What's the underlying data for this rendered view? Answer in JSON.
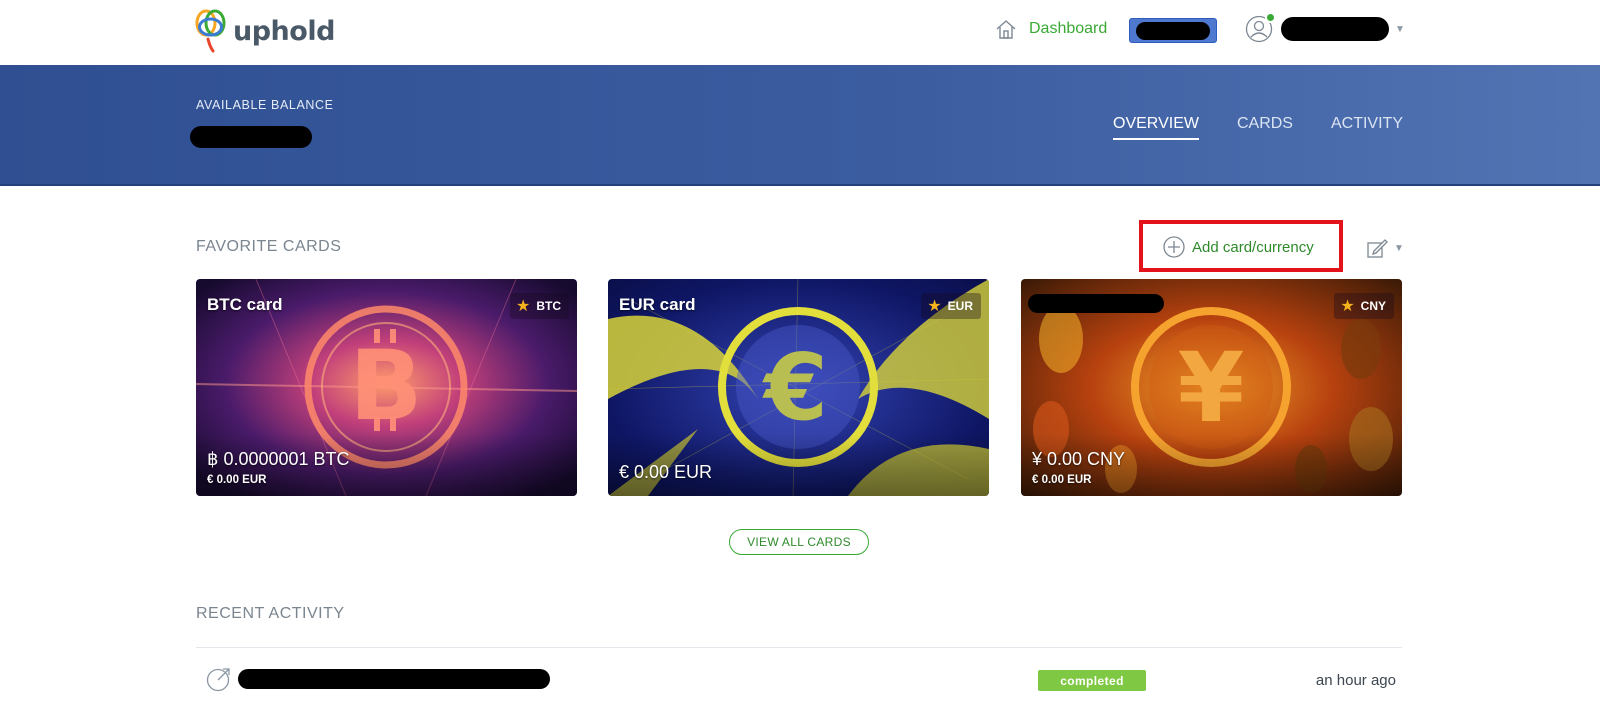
{
  "brand": {
    "name": "uphold"
  },
  "topnav": {
    "dashboard_label": "Dashboard"
  },
  "balance": {
    "label": "AVAILABLE BALANCE"
  },
  "tabs": [
    {
      "label": "OVERVIEW",
      "active": true
    },
    {
      "label": "CARDS",
      "active": false
    },
    {
      "label": "ACTIVITY",
      "active": false
    }
  ],
  "favorites": {
    "title": "FAVORITE CARDS",
    "add_label": "Add card/currency",
    "view_all_label": "VIEW ALL CARDS",
    "cards": [
      {
        "name": "BTC card",
        "code": "BTC",
        "amount": "฿ 0.0000001 BTC",
        "sub": "€ 0.00 EUR",
        "starred": true
      },
      {
        "name": "EUR card",
        "code": "EUR",
        "amount": "€ 0.00 EUR",
        "sub": "",
        "starred": true
      },
      {
        "name": "",
        "code": "CNY",
        "amount": "¥ 0.00 CNY",
        "sub": "€ 0.00 EUR",
        "starred": true
      }
    ]
  },
  "recent": {
    "title": "RECENT ACTIVITY",
    "items": [
      {
        "status": "completed",
        "time": "an hour ago"
      }
    ]
  },
  "colors": {
    "brand_green": "#3aaa35",
    "hero_blue": "#3b5da0",
    "highlight_red": "#e3131b",
    "status_green": "#7fc843"
  }
}
